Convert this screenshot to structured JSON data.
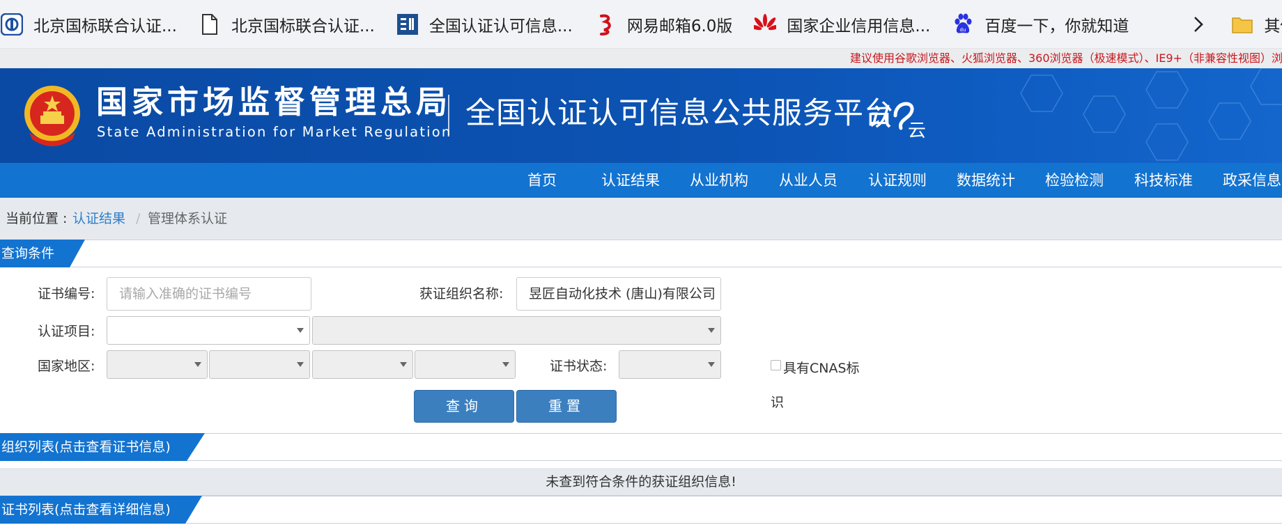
{
  "bookmarks": {
    "items": [
      {
        "label": "北京国标联合认证...",
        "icon": "cert-site-icon"
      },
      {
        "label": "北京国标联合认证...",
        "icon": "document-icon"
      },
      {
        "label": "全国认证认可信息...",
        "icon": "cnca-icon"
      },
      {
        "label": "网易邮箱6.0版",
        "icon": "netease-mail-icon"
      },
      {
        "label": "国家企业信用信息...",
        "icon": "huawei-icon"
      },
      {
        "label": "百度一下，你就知道",
        "icon": "baidu-paw-icon"
      }
    ],
    "other_label": "其他收藏"
  },
  "browser_hint": "建议使用谷歌浏览器、火狐浏览器、360浏览器（极速模式）、IE9+（非兼容性视图）浏览器访问本系统",
  "header": {
    "agency_cn": "国家市场监督管理总局",
    "agency_en": "State Administration  for  Market Regulation",
    "platform": "全国认证认可信息公共服务平台",
    "cloud_logo": "认云"
  },
  "nav": {
    "items": [
      "首页",
      "认证结果",
      "从业机构",
      "从业人员",
      "认证规则",
      "数据统计",
      "检验检测",
      "科技标准",
      "政采信息"
    ]
  },
  "breadcrumb": {
    "label": "当前位置 :",
    "link": "认证结果",
    "separator": "/",
    "current": "管理体系认证"
  },
  "query": {
    "title": "查询条件",
    "cert_no_label": "证书编号:",
    "cert_no_placeholder": "请输入准确的证书编号",
    "org_name_label": "获证组织名称:",
    "org_name_value": "昱匠自动化技术 (唐山)有限公司",
    "cert_item_label": "认证项目:",
    "region_label": "国家地区:",
    "status_label": "证书状态:",
    "cnas_label": "具有CNAS标",
    "cnas_label_wrap": "识",
    "query_button": "查询",
    "reset_button": "重置"
  },
  "org_list": {
    "title": "组织列表(点击查看证书信息)",
    "empty_message": "未查到符合条件的获证组织信息!"
  },
  "cert_list": {
    "title": "证书列表(点击查看详细信息)"
  },
  "colors": {
    "banner": "#0c53b3",
    "nav": "#1373d0",
    "button": "#3c7fbf",
    "link": "#2f7ec9",
    "hint": "#c8181d"
  }
}
